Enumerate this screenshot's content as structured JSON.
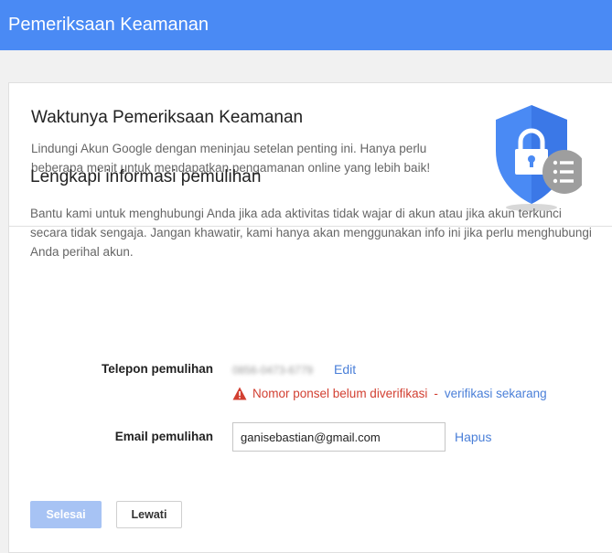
{
  "app": {
    "title": "Pemeriksaan Keamanan"
  },
  "intro": {
    "heading": "Waktunya Pemeriksaan Keamanan",
    "description": "Lindungi Akun Google dengan meninjau setelan penting ini. Hanya perlu beberapa menit untuk mendapatkan pengamanan online yang lebih baik!"
  },
  "recovery": {
    "heading": "Lengkapi informasi pemulihan",
    "description": "Bantu kami untuk menghubungi Anda jika ada aktivitas tidak wajar di akun atau jika akun terkunci secara tidak sengaja. Jangan khawatir, kami hanya akan menggunakan info ini jika perlu menghubungi Anda perihal akun.",
    "phone": {
      "label": "Telepon pemulihan",
      "value_blurred": "0856-0473-6779",
      "edit_label": "Edit",
      "warning_text": "Nomor ponsel belum diverifikasi",
      "warning_sep": "-",
      "verify_label": "verifikasi sekarang"
    },
    "email": {
      "label": "Email pemulihan",
      "value": "ganisebastian@gmail.com",
      "remove_label": "Hapus"
    }
  },
  "actions": {
    "done_label": "Selesai",
    "skip_label": "Lewati"
  },
  "colors": {
    "header": "#4a8af4",
    "link": "#4a7fd8",
    "warning": "#d23f31",
    "shield": "#4a8af4"
  }
}
